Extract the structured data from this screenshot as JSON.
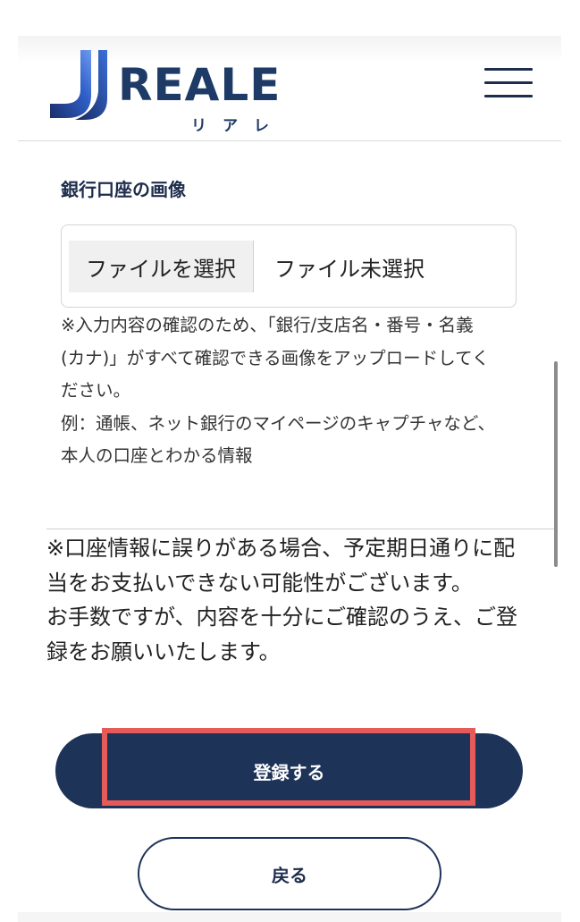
{
  "header": {
    "logo_text": "REALE",
    "logo_sub": "リアレ",
    "menu_icon": "hamburger-menu-icon"
  },
  "section": {
    "title": "銀行口座の画像"
  },
  "file_input": {
    "button_label": "ファイルを選択",
    "status": "ファイル未選択"
  },
  "note1": {
    "lines": [
      "※入力内容の確認のため、「銀行/支店名・番号・名義",
      "(カナ)」がすべて確認できる画像をアップロードしてく",
      "ださい。",
      "例：通帳、ネット銀行のマイページのキャプチャなど、",
      "本人の口座とわかる情報"
    ]
  },
  "note2": {
    "lines": [
      "※口座情報に誤りがある場合、予定期日通りに配",
      "当をお支払いできない可能性がございます。",
      "お手数ですが、内容を十分にご確認のうえ、ご登",
      "録をお願いいたします。"
    ]
  },
  "buttons": {
    "register": "登録する",
    "back": "戻る"
  },
  "colors": {
    "brand_navy": "#1e3358",
    "highlight_red": "#e65a5a",
    "logo_blue": "#2c5cc5"
  }
}
